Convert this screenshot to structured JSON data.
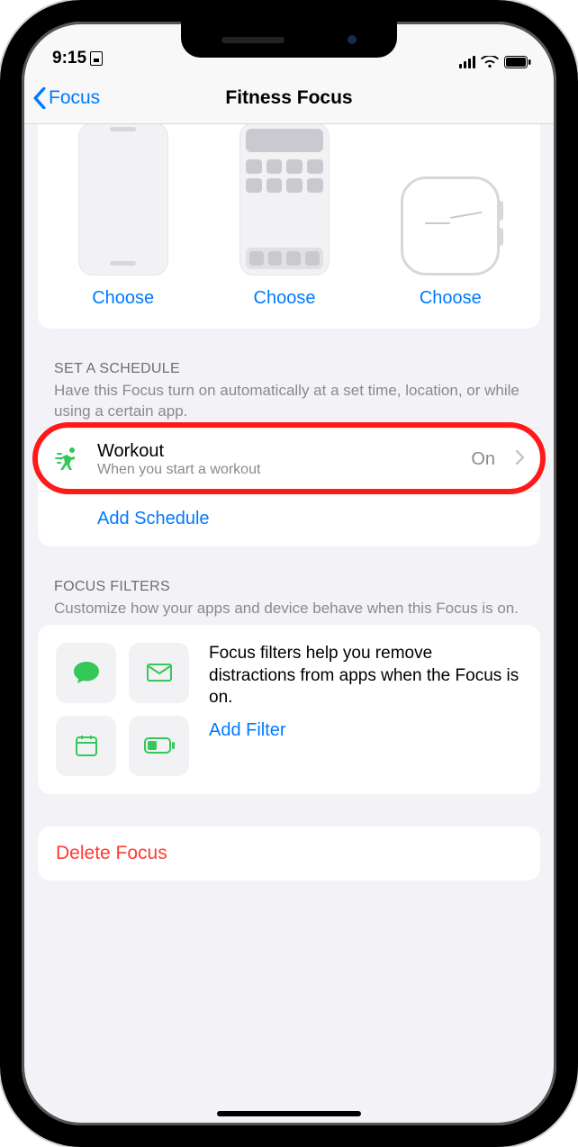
{
  "status": {
    "time": "9:15"
  },
  "nav": {
    "back_label": "Focus",
    "title": "Fitness Focus"
  },
  "customize": {
    "lock_label": "Choose",
    "home_label": "Choose",
    "watch_label": "Choose"
  },
  "schedule": {
    "header": "SET A SCHEDULE",
    "description": "Have this Focus turn on automatically at a set time, location, or while using a certain app.",
    "workout": {
      "title": "Workout",
      "subtitle": "When you start a workout",
      "status": "On"
    },
    "add_label": "Add Schedule"
  },
  "filters": {
    "header": "FOCUS FILTERS",
    "description": "Customize how your apps and device behave when this Focus is on.",
    "info": "Focus filters help you remove distractions from apps when the Focus is on.",
    "add_label": "Add Filter"
  },
  "delete": {
    "label": "Delete Focus"
  }
}
